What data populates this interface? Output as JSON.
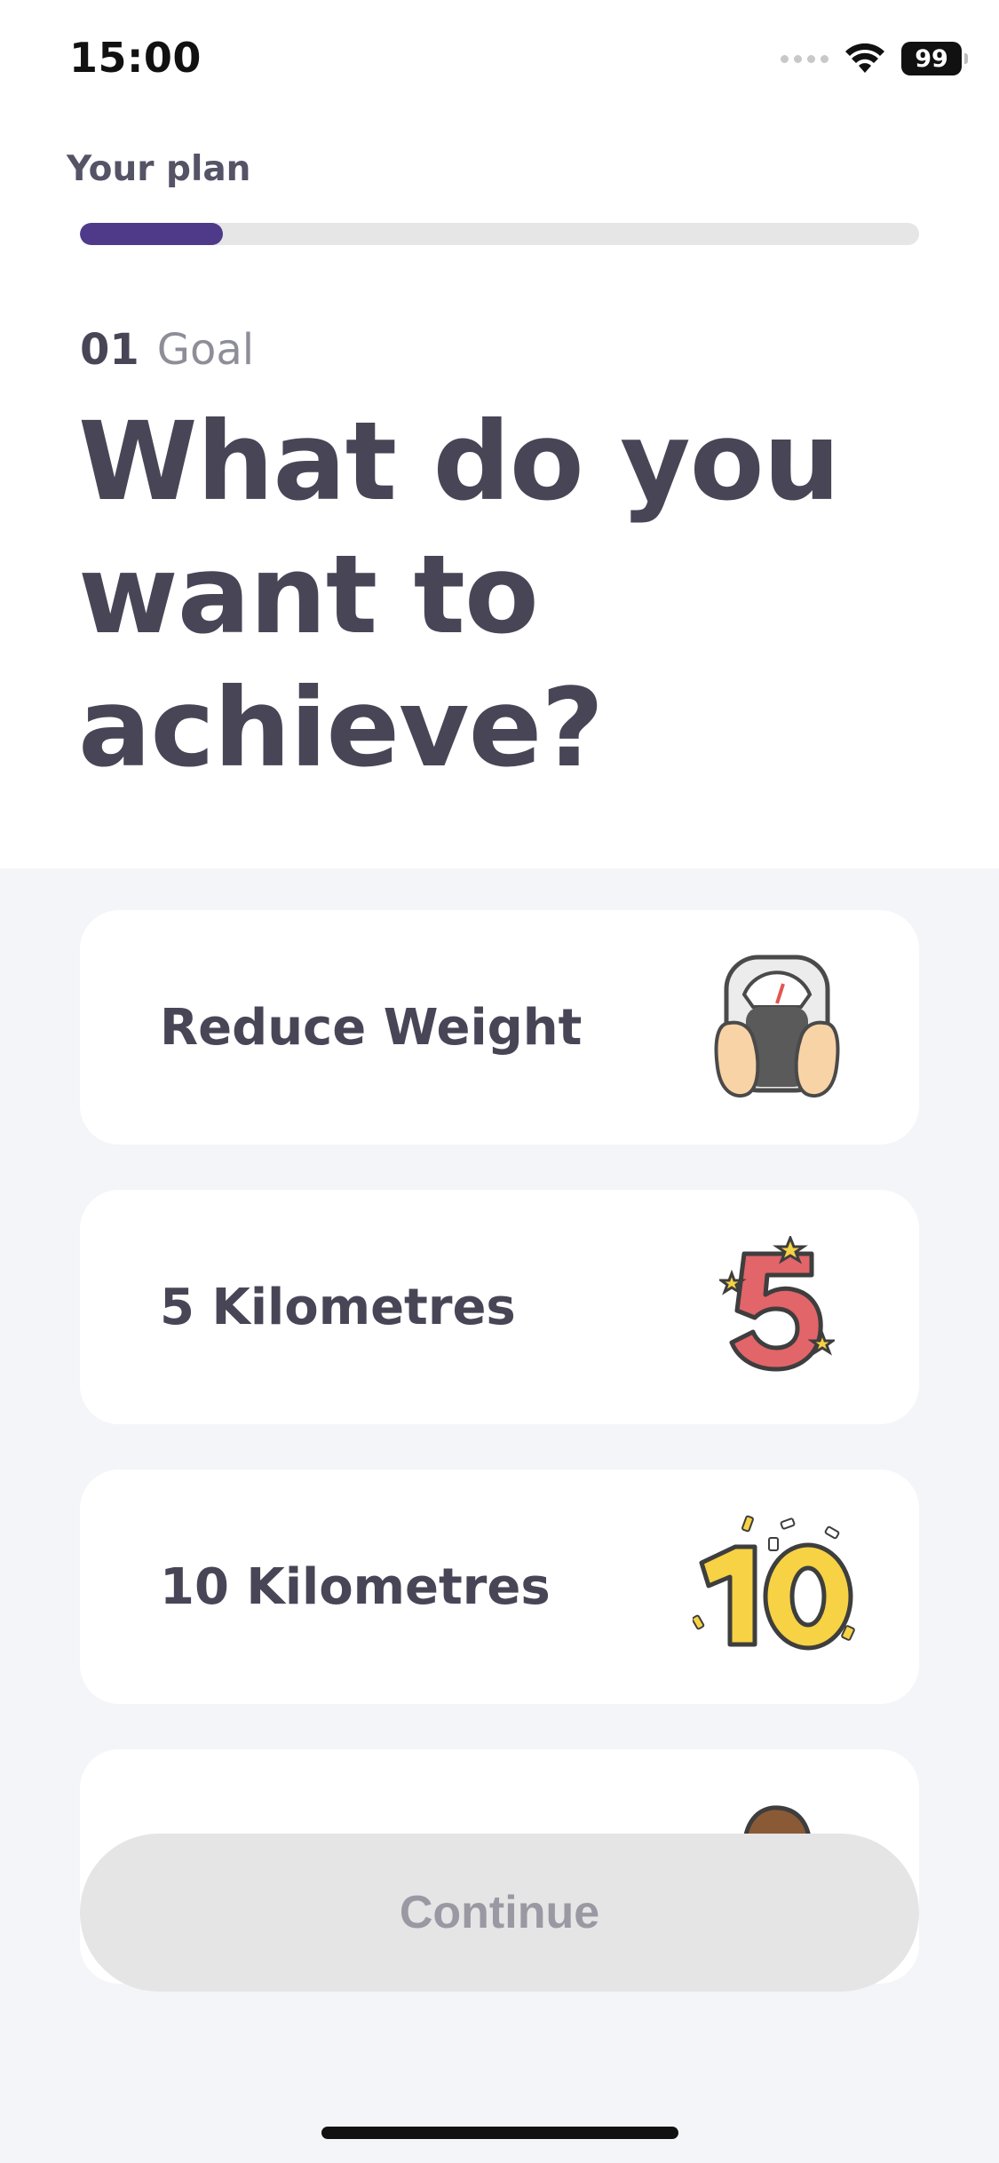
{
  "status_bar": {
    "time": "15:00",
    "battery": "99",
    "icons": [
      "signal-icon",
      "wifi-icon",
      "battery-icon"
    ]
  },
  "header": {
    "plan_label": "Your plan",
    "progress": 0.17
  },
  "question": {
    "step_number": "01",
    "step_name": "Goal",
    "title": "What do you want to achieve?"
  },
  "options": [
    {
      "label": "Reduce Weight",
      "icon": "scale-icon"
    },
    {
      "label": "5 Kilometres",
      "icon": "number-five-icon"
    },
    {
      "label": "10 Kilometres",
      "icon": "number-ten-icon"
    },
    {
      "label": "",
      "icon": "person-icon"
    }
  ],
  "continue_label": "Continue",
  "colors": {
    "accent": "#4f3a8a",
    "text": "#484656",
    "background_options": "#f4f5f9",
    "button_disabled": "#e5e5e6"
  }
}
